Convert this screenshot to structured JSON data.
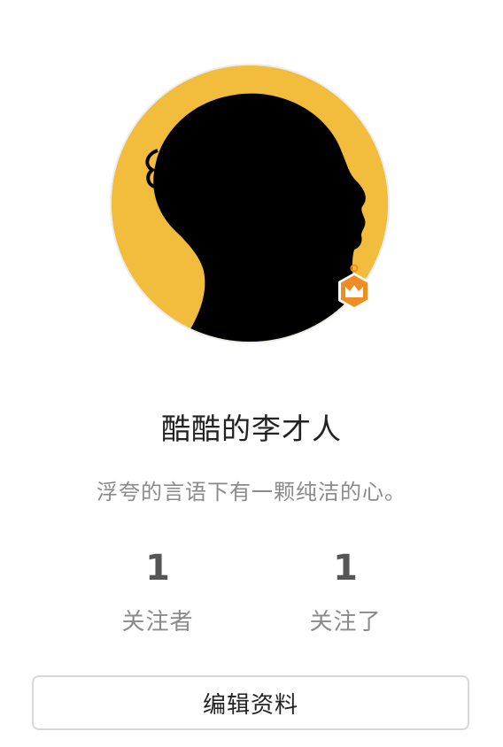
{
  "profile": {
    "name": "酷酷的李才人",
    "bio": "浮夸的言语下有一颗纯洁的心。",
    "avatar_bg_color": "#f2bd3c",
    "badge_icon": "crown-icon",
    "badge_color": "#f08c24"
  },
  "stats": {
    "followers": {
      "count": "1",
      "label": "关注者"
    },
    "following": {
      "count": "1",
      "label": "关注了"
    }
  },
  "actions": {
    "edit_label": "编辑资料"
  }
}
